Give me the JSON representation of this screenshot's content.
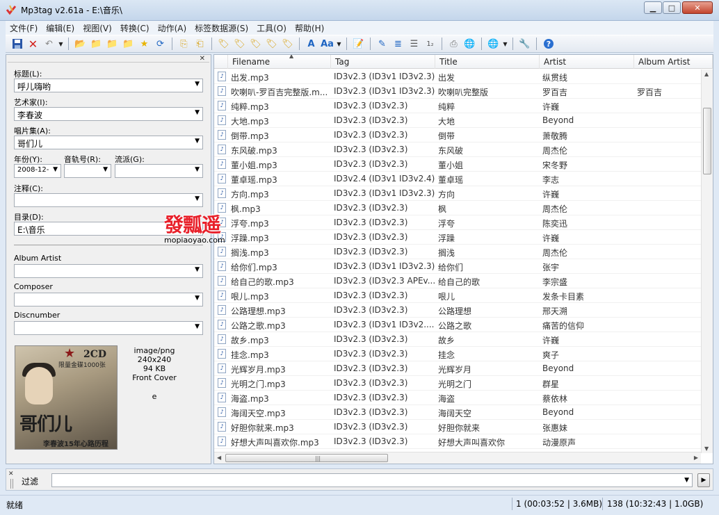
{
  "window": {
    "title": "Mp3tag v2.61a  -  E:\\音乐\\",
    "min_icon": "minimize-icon",
    "max_icon": "maximize-icon",
    "close_icon": "close-icon"
  },
  "menu": [
    "文件(F)",
    "编辑(E)",
    "视图(V)",
    "转换(C)",
    "动作(A)",
    "标签数据源(S)",
    "工具(O)",
    "帮助(H)"
  ],
  "toolbar_icons": [
    "save-icon",
    "remove-tag-icon",
    "undo-icon",
    "open-folder-icon",
    "add-folder-icon",
    "favorite-folder-icon",
    "star-icon",
    "refresh-icon",
    "copy-tag-icon",
    "paste-tag-icon",
    "tag-to-filename-icon",
    "filename-to-tag-icon",
    "text-to-tag-icon",
    "tag-to-text-icon",
    "autonumber-icon",
    "case-convert-icon",
    "edit-icon",
    "export-icon",
    "playlist-icon",
    "print-icon",
    "globe-icon",
    "web-sources-icon",
    "tools-icon",
    "help-icon"
  ],
  "left": {
    "fields": {
      "title": {
        "label": "标题(L):",
        "value": "呼儿嗨哟"
      },
      "artist": {
        "label": "艺术家(I):",
        "value": "李春波"
      },
      "album": {
        "label": "唱片集(A):",
        "value": "哥们儿"
      },
      "year": {
        "label": "年份(Y):",
        "value": "2008-12-"
      },
      "track": {
        "label": "音轨号(R):",
        "value": ""
      },
      "genre": {
        "label": "流派(G):",
        "value": ""
      },
      "comment": {
        "label": "注释(C):",
        "value": ""
      },
      "directory": {
        "label": "目录(D):",
        "value": "E:\\音乐"
      },
      "album_artist": {
        "label": "Album Artist",
        "value": ""
      },
      "composer": {
        "label": "Composer",
        "value": ""
      },
      "discnumber": {
        "label": "Discnumber",
        "value": ""
      }
    },
    "artwork": {
      "type": "image/png",
      "size": "240x240",
      "filesize": "94 KB",
      "kind": "Front Cover",
      "desc": "e",
      "cover_text_top": "2CD",
      "cover_text_mid": "限量金碟1000张",
      "cover_text_title": "哥们儿",
      "cover_text_bottom": "李春波15年心路历程"
    }
  },
  "watermark": {
    "big": "發瓢遥",
    "small": "mopiaoyao.com"
  },
  "grid": {
    "columns": [
      "Filename",
      "Tag",
      "Title",
      "Artist",
      "Album Artist"
    ],
    "rows": [
      {
        "filename": "出发.mp3",
        "tag": "ID3v2.3 (ID3v1 ID3v2.3)",
        "title": "出发",
        "artist": "纵贯线",
        "album_artist": ""
      },
      {
        "filename": "吹喇叭-罗百吉完整版.m...",
        "tag": "ID3v2.3 (ID3v1 ID3v2.3)",
        "title": "吹喇叭完整版",
        "artist": "罗百吉",
        "album_artist": "罗百吉"
      },
      {
        "filename": "纯粹.mp3",
        "tag": "ID3v2.3 (ID3v2.3)",
        "title": "纯粹",
        "artist": "许巍",
        "album_artist": ""
      },
      {
        "filename": "大地.mp3",
        "tag": "ID3v2.3 (ID3v2.3)",
        "title": "大地",
        "artist": "Beyond",
        "album_artist": ""
      },
      {
        "filename": "倒带.mp3",
        "tag": "ID3v2.3 (ID3v2.3)",
        "title": "倒带",
        "artist": "萧敬腾",
        "album_artist": ""
      },
      {
        "filename": "东风破.mp3",
        "tag": "ID3v2.3 (ID3v2.3)",
        "title": "东风破",
        "artist": "周杰伦",
        "album_artist": ""
      },
      {
        "filename": "董小姐.mp3",
        "tag": "ID3v2.3 (ID3v2.3)",
        "title": "董小姐",
        "artist": "宋冬野",
        "album_artist": ""
      },
      {
        "filename": "董卓瑶.mp3",
        "tag": "ID3v2.4 (ID3v1 ID3v2.4)",
        "title": "董卓瑶",
        "artist": "李志",
        "album_artist": ""
      },
      {
        "filename": "方向.mp3",
        "tag": "ID3v2.3 (ID3v1 ID3v2.3)",
        "title": "方向",
        "artist": "许巍",
        "album_artist": ""
      },
      {
        "filename": "枫.mp3",
        "tag": "ID3v2.3 (ID3v2.3)",
        "title": "枫",
        "artist": "周杰伦",
        "album_artist": ""
      },
      {
        "filename": "浮夸.mp3",
        "tag": "ID3v2.3 (ID3v2.3)",
        "title": "浮夸",
        "artist": "陈奕迅",
        "album_artist": ""
      },
      {
        "filename": "浮躁.mp3",
        "tag": "ID3v2.3 (ID3v2.3)",
        "title": "浮躁",
        "artist": "许巍",
        "album_artist": ""
      },
      {
        "filename": "搁浅.mp3",
        "tag": "ID3v2.3 (ID3v2.3)",
        "title": "搁浅",
        "artist": "周杰伦",
        "album_artist": ""
      },
      {
        "filename": "给你们.mp3",
        "tag": "ID3v2.3 (ID3v1 ID3v2.3)",
        "title": "给你们",
        "artist": "张宇",
        "album_artist": ""
      },
      {
        "filename": "给自己的歌.mp3",
        "tag": "ID3v2.3 (ID3v2.3 APEv...",
        "title": "给自己的歌",
        "artist": "李宗盛",
        "album_artist": ""
      },
      {
        "filename": "哏儿.mp3",
        "tag": "ID3v2.3 (ID3v2.3)",
        "title": "哏儿",
        "artist": "发条卡目素",
        "album_artist": ""
      },
      {
        "filename": "公路理想.mp3",
        "tag": "ID3v2.3 (ID3v2.3)",
        "title": "公路理想",
        "artist": "邢天溯",
        "album_artist": ""
      },
      {
        "filename": "公路之歌.mp3",
        "tag": "ID3v2.3 (ID3v1 ID3v2....",
        "title": "公路之歌",
        "artist": "痛苦的信仰",
        "album_artist": ""
      },
      {
        "filename": "故乡.mp3",
        "tag": "ID3v2.3 (ID3v2.3)",
        "title": "故乡",
        "artist": "许巍",
        "album_artist": ""
      },
      {
        "filename": "挂念.mp3",
        "tag": "ID3v2.3 (ID3v2.3)",
        "title": "挂念",
        "artist": "爽子",
        "album_artist": ""
      },
      {
        "filename": "光辉岁月.mp3",
        "tag": "ID3v2.3 (ID3v2.3)",
        "title": "光辉岁月",
        "artist": "Beyond",
        "album_artist": ""
      },
      {
        "filename": "光明之门.mp3",
        "tag": "ID3v2.3 (ID3v2.3)",
        "title": "光明之门",
        "artist": "群星",
        "album_artist": ""
      },
      {
        "filename": "海盗.mp3",
        "tag": "ID3v2.3 (ID3v2.3)",
        "title": "海盗",
        "artist": "蔡依林",
        "album_artist": ""
      },
      {
        "filename": "海阔天空.mp3",
        "tag": "ID3v2.3 (ID3v2.3)",
        "title": "海阔天空",
        "artist": "Beyond",
        "album_artist": ""
      },
      {
        "filename": "好胆你就来.mp3",
        "tag": "ID3v2.3 (ID3v2.3)",
        "title": "好胆你就来",
        "artist": "张惠妹",
        "album_artist": ""
      },
      {
        "filename": "好想大声叫喜欢你.mp3",
        "tag": "ID3v2.3 (ID3v2.3)",
        "title": "好想大声叫喜欢你",
        "artist": "动漫原声",
        "album_artist": ""
      }
    ]
  },
  "filter": {
    "label": "过滤",
    "value": ""
  },
  "status": {
    "left": "就绪",
    "selected": "1 (00:03:52 | 3.6MB)",
    "total": "138 (10:32:43 | 1.0GB)"
  }
}
